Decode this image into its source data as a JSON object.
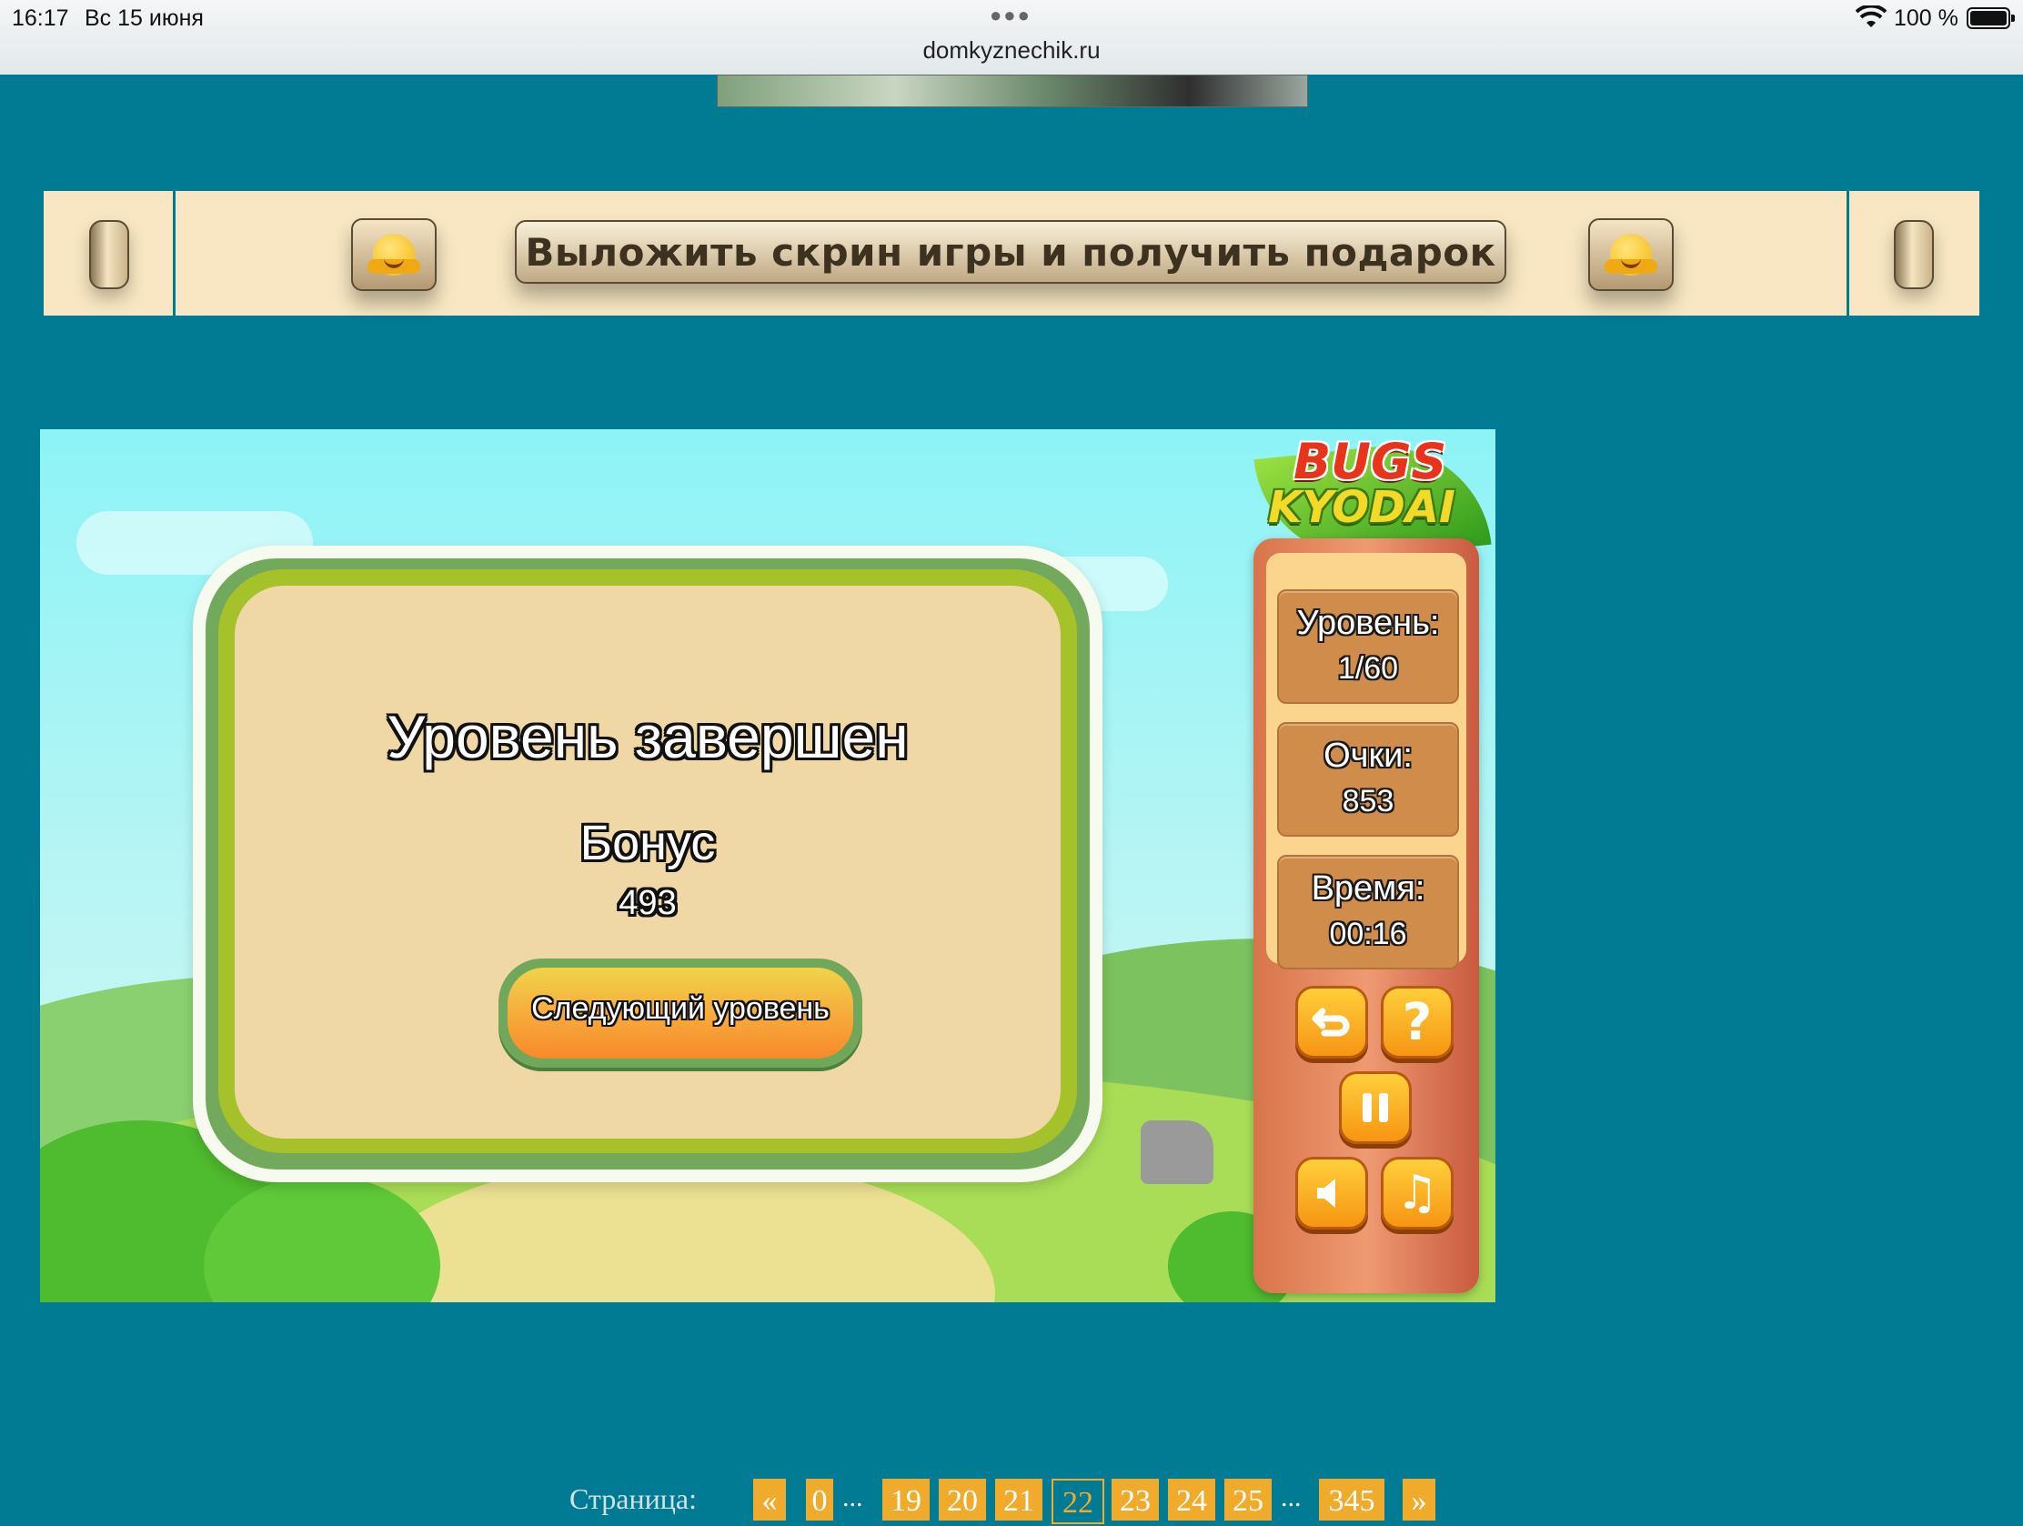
{
  "status_bar": {
    "time": "16:17",
    "date": "Вс 15 июня",
    "url": "domkyznechik.ru",
    "battery": "100 %"
  },
  "promo": {
    "label": "Выложить скрин игры и получить подарок",
    "left_icon": "hugging-face-emoji",
    "right_icon": "hugging-face-emoji"
  },
  "game": {
    "logo": {
      "line1": "BUGS",
      "line2": "KYODAI"
    },
    "dialog": {
      "title": "Уровень завершен",
      "bonus_label": "Бонус",
      "bonus_value": "493",
      "next_button": "Следующий уровень"
    },
    "panel": {
      "level_label": "Уровень:",
      "level_value": "1/60",
      "score_label": "Очки:",
      "score_value": "853",
      "time_label": "Время:",
      "time_value": "00:16",
      "buttons": [
        "undo-icon",
        "help-icon",
        "pause-icon",
        "sound-icon",
        "music-icon"
      ]
    }
  },
  "pagination": {
    "label": "Страница:",
    "prev": "«",
    "next": "»",
    "pages": [
      "0",
      "19",
      "20",
      "21",
      "22",
      "23",
      "24",
      "25",
      "345"
    ],
    "current": "22",
    "ellipsis": "..."
  },
  "colors": {
    "page_background": "#017a94",
    "accent_orange": "#f0ab2c",
    "banner_background": "#f8e7c2"
  }
}
